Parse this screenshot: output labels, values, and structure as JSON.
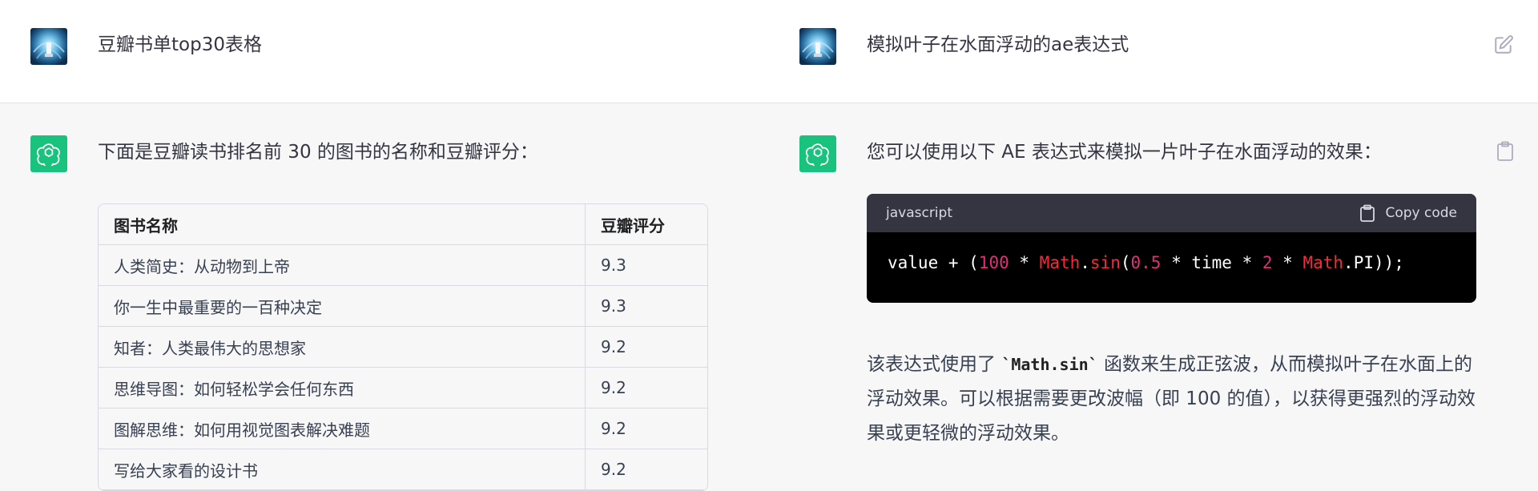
{
  "left": {
    "user_message": "豆瓣书单top30表格",
    "assistant_intro": "下面是豆瓣读书排名前 30 的图书的名称和豆瓣评分：",
    "table": {
      "headers": [
        "图书名称",
        "豆瓣评分"
      ],
      "rows": [
        [
          "人类简史：从动物到上帝",
          "9.3"
        ],
        [
          "你一生中最重要的一百种决定",
          "9.3"
        ],
        [
          "知者：人类最伟大的思想家",
          "9.2"
        ],
        [
          "思维导图：如何轻松学会任何东西",
          "9.2"
        ],
        [
          "图解思维：如何用视觉图表解决难题",
          "9.2"
        ],
        [
          "写给大家看的设计书",
          "9.2"
        ]
      ]
    }
  },
  "right": {
    "user_message": "模拟叶子在水面浮动的ae表达式",
    "assistant_intro": "您可以使用以下 AE 表达式来模拟一片叶子在水面浮动的效果：",
    "code": {
      "language": "javascript",
      "copy_label": "Copy code",
      "tokens": {
        "t1": "value + (",
        "t2": "100",
        "t3": " * ",
        "t4": "Math",
        "t5": ".",
        "t6": "sin",
        "t7": "(",
        "t8": "0.5",
        "t9": " * time * ",
        "t10": "2",
        "t11": " * ",
        "t12": "Math",
        "t13": ".PI));"
      }
    },
    "explanation": {
      "before": "该表达式使用了 ",
      "code": "`Math.sin`",
      "after": " 函数来生成正弦波，从而模拟叶子在水面上的浮动效果。可以根据需要更改波幅（即 100 的值），以获得更强烈的浮动效果或更轻微的浮动效果。"
    }
  },
  "icons": {
    "edit": "edit-icon",
    "clipboard": "clipboard-icon",
    "copy": "copy-icon",
    "assistant": "openai-logo-icon",
    "user": "user-avatar"
  },
  "colors": {
    "assistant_avatar": "#19c37d",
    "code_header": "#343541",
    "code_bg": "#000000",
    "code_number": "#df3079",
    "code_object": "#f22c3d"
  }
}
